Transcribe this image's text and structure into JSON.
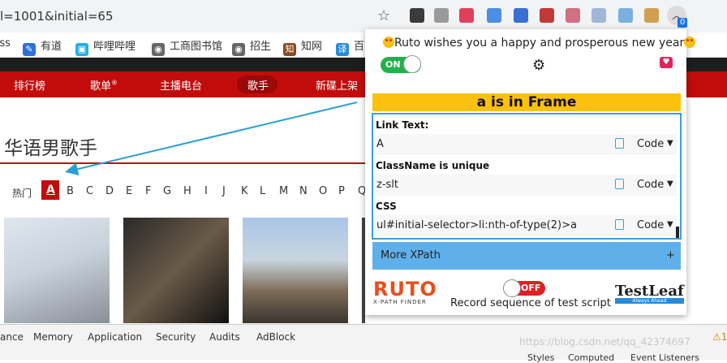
{
  "browser": {
    "url": "l=1001&initial=65",
    "extensions_badge": "0",
    "bookmarks": [
      {
        "label": "rss"
      },
      {
        "label": "有道"
      },
      {
        "label": "哔哩哔哩"
      },
      {
        "label": "工商图书馆"
      },
      {
        "label": "招生"
      },
      {
        "label": "知网"
      },
      {
        "label": "百"
      }
    ]
  },
  "page": {
    "nav": [
      "排行榜",
      "歌单",
      "主播电台",
      "歌手",
      "新碟上架"
    ],
    "nav_sup": "®",
    "heading": "华语男歌手",
    "hot_label": "热门",
    "letters": [
      "A",
      "B",
      "C",
      "D",
      "E",
      "F",
      "G",
      "H",
      "I",
      "J",
      "K",
      "L",
      "M",
      "N",
      "O",
      "P",
      "Q"
    ]
  },
  "devtools": {
    "tabs": [
      "ance",
      "Memory",
      "Application",
      "Security",
      "Audits",
      "AdBlock"
    ],
    "warn_count": "1",
    "bottom_tabs": [
      "Styles",
      "Computed",
      "Event Listeners"
    ],
    "watermark": "https://blog.csdn.net/qq_42374697"
  },
  "popup": {
    "greeting": "Ruto wishes you a happy and prosperous new year",
    "toggle_on_label": "ON",
    "frame_banner": "a is in Frame",
    "locators": [
      {
        "title": "Link Text:",
        "value": "A",
        "code_label": "Code"
      },
      {
        "title": "ClassName is unique",
        "value": "z-slt",
        "code_label": "Code"
      },
      {
        "title": "CSS",
        "value": "ul#initial-selector>li:nth-of-type(2)>a",
        "code_label": "Code"
      }
    ],
    "more_xpath": "More XPath",
    "more_plus": "+",
    "ruto_word": "RUTO",
    "ruto_sub": "X-PATH FINDER",
    "toggle_off_label": "OFF",
    "record_text": "Record sequence of test script",
    "testleaf_word": "TestLeaf",
    "testleaf_tag": "Always Ahead"
  },
  "colors": {
    "accent_red": "#c20c0c",
    "frame_yellow": "#fcc10f",
    "locator_border": "#3aa0d8",
    "more_xpath_bg": "#5fb0ea",
    "toggle_on": "#22b14c",
    "toggle_off": "#e02020"
  }
}
